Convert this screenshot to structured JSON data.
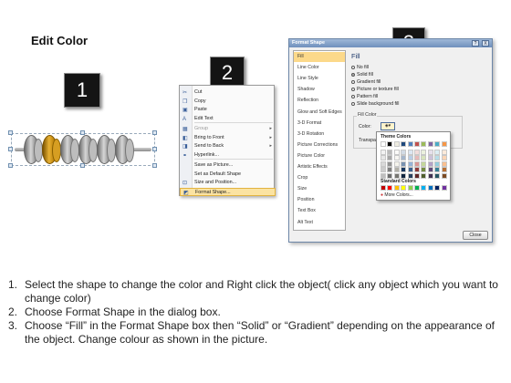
{
  "title": "Edit Color",
  "badges": {
    "one": "1",
    "two": "2",
    "three": "3"
  },
  "context_menu": {
    "items": [
      {
        "icon": "scissors-icon",
        "glyph": "✂",
        "label": "Cut",
        "state": "normal"
      },
      {
        "icon": "copy-icon",
        "glyph": "❐",
        "label": "Copy",
        "state": "normal"
      },
      {
        "icon": "paste-icon",
        "glyph": "▣",
        "label": "Paste",
        "state": "normal"
      },
      {
        "icon": "edit-text-icon",
        "glyph": "A",
        "label": "Edit Text",
        "state": "normal"
      },
      {
        "icon": "group-icon",
        "glyph": "▦",
        "label": "Group",
        "state": "disabled",
        "submenu": true
      },
      {
        "icon": "bring-to-front-icon",
        "glyph": "◧",
        "label": "Bring to Front",
        "state": "normal",
        "submenu": true
      },
      {
        "icon": "send-to-back-icon",
        "glyph": "◨",
        "label": "Send to Back",
        "state": "normal",
        "submenu": true
      },
      {
        "icon": "hyperlink-icon",
        "glyph": "⚭",
        "label": "Hyperlink...",
        "state": "normal"
      },
      {
        "icon": "save-picture-icon",
        "glyph": "",
        "label": "Save as Picture...",
        "state": "normal"
      },
      {
        "icon": "default-shape-icon",
        "glyph": "",
        "label": "Set as Default Shape",
        "state": "normal"
      },
      {
        "icon": "size-position-icon",
        "glyph": "⊡",
        "label": "Size and Position...",
        "state": "normal"
      },
      {
        "icon": "format-shape-icon",
        "glyph": "◩",
        "label": "Format Shape...",
        "state": "highlighted"
      }
    ]
  },
  "dialog": {
    "title": "Format Shape",
    "help_glyph": "?",
    "close_glyph": "X",
    "nav": [
      "Fill",
      "Line Color",
      "Line Style",
      "Shadow",
      "Reflection",
      "Glow and Soft Edges",
      "3-D Format",
      "3-D Rotation",
      "Picture Corrections",
      "Picture Color",
      "Artistic Effects",
      "Crop",
      "Size",
      "Position",
      "Text Box",
      "Alt Text"
    ],
    "active_nav": "Fill",
    "pane_heading": "Fill",
    "fill_options": [
      {
        "label": "No fill",
        "selected": false
      },
      {
        "label": "Solid fill",
        "selected": true
      },
      {
        "label": "Gradient fill",
        "selected": false
      },
      {
        "label": "Picture or texture fill",
        "selected": false
      },
      {
        "label": "Pattern fill",
        "selected": false
      },
      {
        "label": "Slide background fill",
        "selected": false
      }
    ],
    "fill_color_group": "Fill Color",
    "color_label": "Color:",
    "transparency_label": "Transpa",
    "close_button": "Close"
  },
  "palette": {
    "theme_label": "Theme Colors",
    "standard_label": "Standard Colors",
    "more_colors": "More Colors...",
    "theme_columns": [
      "#ffffff",
      "#000000",
      "#eeece1",
      "#1f497d",
      "#4f81bd",
      "#c0504d",
      "#9bbb59",
      "#8064a2",
      "#4bacc6",
      "#f79646"
    ],
    "standard": [
      "#c00000",
      "#ff0000",
      "#ffc000",
      "#ffff00",
      "#92d050",
      "#00b050",
      "#00b0f0",
      "#0070c0",
      "#002060",
      "#7030a0"
    ]
  },
  "instructions": [
    {
      "num": "1.",
      "text": "Select the shape to change the color and Right click the object( click any object which you want to change color)"
    },
    {
      "num": "2.",
      "text": "Choose Format Shape in the dialog box."
    },
    {
      "num": "3.",
      "text": "Choose “Fill” in the Format Shape box then “Solid” or “Gradient” depending on the appearance of the object. Change colour as shown in the picture."
    }
  ]
}
